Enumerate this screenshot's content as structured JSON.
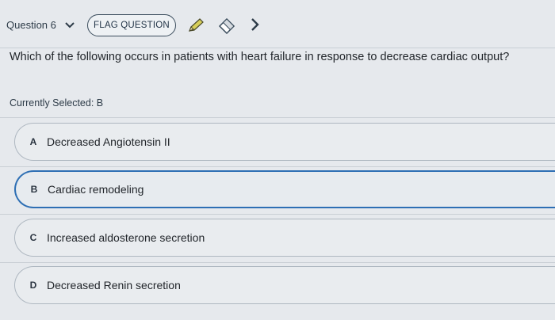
{
  "header": {
    "question_selector": "Question 6",
    "flag_label": "FLAG QUESTION"
  },
  "question": {
    "text": "Which of the following occurs in patients with heart failure in response to decrease cardiac output?",
    "current_selection": "Currently Selected: B"
  },
  "options": [
    {
      "letter": "A",
      "text": "Decreased Angiotensin II"
    },
    {
      "letter": "B",
      "text": "Cardiac remodeling"
    },
    {
      "letter": "C",
      "text": "Increased aldosterone secretion"
    },
    {
      "letter": "D",
      "text": "Decreased Renin secretion"
    }
  ],
  "colors": {
    "selected_border": "#2e6fb4",
    "pencil": "#c9c24a"
  },
  "icons": [
    "chevron-down-icon",
    "pencil-icon",
    "eraser-icon",
    "chevron-right-icon"
  ]
}
